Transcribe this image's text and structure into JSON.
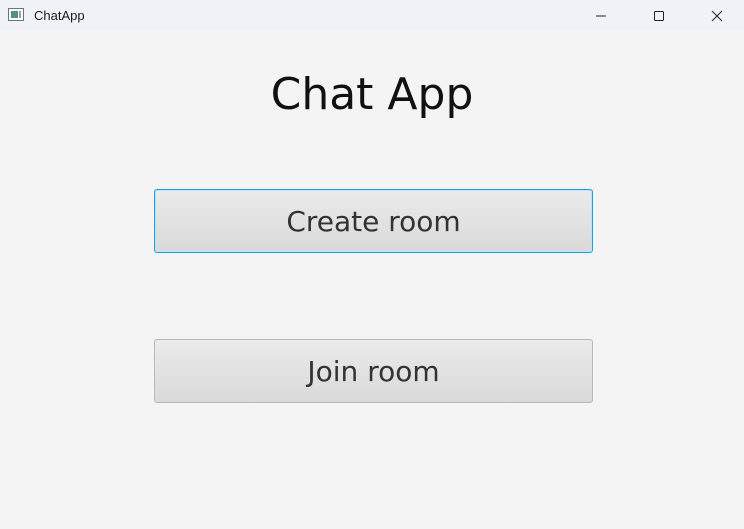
{
  "window": {
    "title": "ChatApp",
    "icon": "app-window-icon",
    "controls": {
      "minimize_icon": "minimize-icon",
      "maximize_icon": "maximize-icon",
      "close_icon": "close-icon"
    }
  },
  "main": {
    "heading": "Chat App",
    "buttons": {
      "create_room": "Create room",
      "join_room": "Join room"
    },
    "focused_button": "create_room"
  },
  "colors": {
    "background": "#f4f4f4",
    "titlebar": "#eff3f8",
    "focus_ring": "#1fa0e0",
    "button_text": "#333333"
  }
}
